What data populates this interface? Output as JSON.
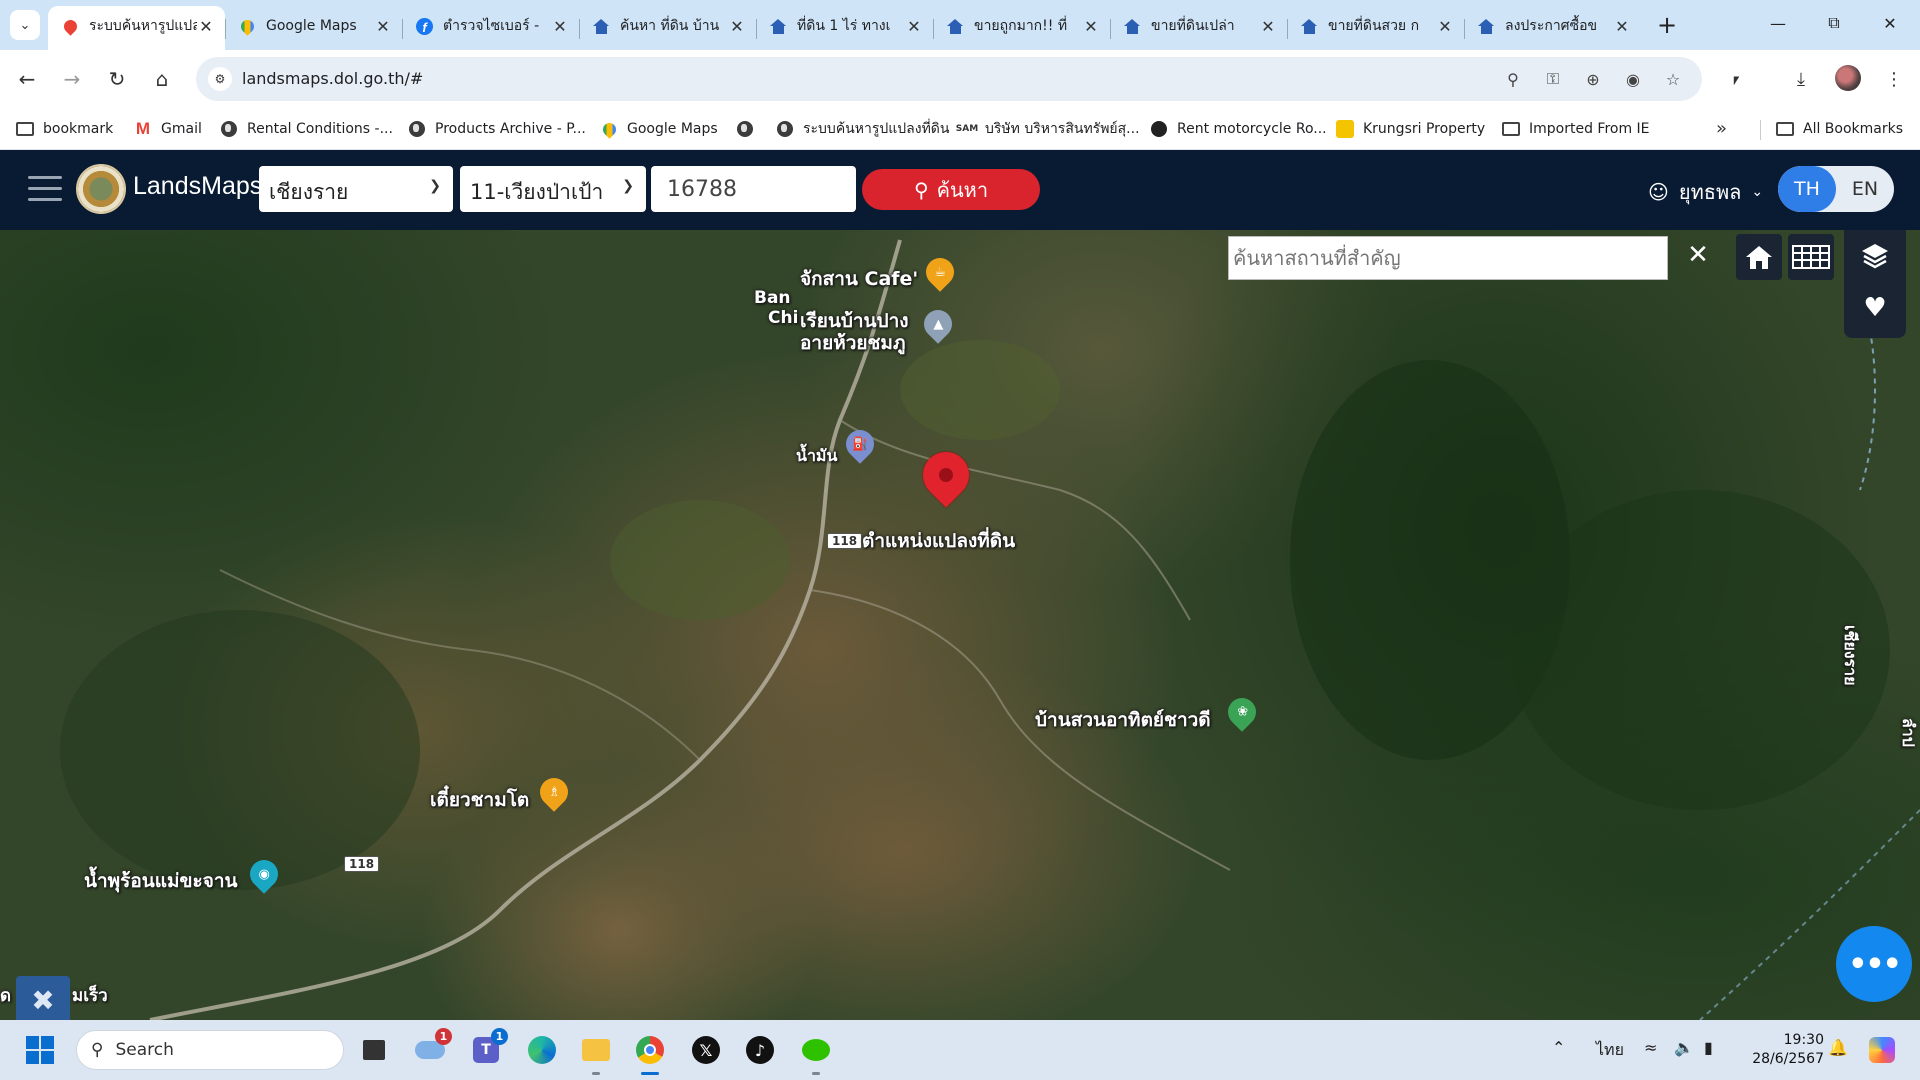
{
  "browser": {
    "tabs": [
      {
        "title": "ระบบค้นหารูปแปลงที่ดิน",
        "icon": "red-pin-icon",
        "active": true
      },
      {
        "title": "Google Maps",
        "icon": "google-maps-icon",
        "active": false
      },
      {
        "title": "ตำรวจไซเบอร์ -",
        "icon": "facebook-icon",
        "active": false
      },
      {
        "title": "ค้นหา ที่ดิน บ้าน",
        "icon": "house-icon",
        "active": false
      },
      {
        "title": "ที่ดิน 1 ไร่ ทางเ",
        "icon": "house-icon",
        "active": false
      },
      {
        "title": "ขายถูกมาก!! ที่",
        "icon": "house-icon",
        "active": false
      },
      {
        "title": "ขายที่ดินเปล่า ",
        "icon": "house-icon",
        "active": false
      },
      {
        "title": "ขายที่ดินสวย ก",
        "icon": "house-icon",
        "active": false
      },
      {
        "title": "ลงประกาศซื้อข",
        "icon": "house-icon",
        "active": false
      }
    ],
    "url": "landsmaps.dol.go.th/#",
    "bookmarks": [
      {
        "label": "bookmark",
        "icon": "folder-icon"
      },
      {
        "label": "Gmail",
        "icon": "gmail-icon"
      },
      {
        "label": "Rental Conditions -...",
        "icon": "globe-icon"
      },
      {
        "label": "Products Archive - P...",
        "icon": "globe-icon"
      },
      {
        "label": "Google Maps",
        "icon": "google-maps-icon"
      },
      {
        "label": "",
        "icon": "globe-icon"
      },
      {
        "label": "ระบบค้นหารูปแปลงที่ดิน",
        "icon": "globe-icon"
      },
      {
        "label": "บริษัท บริหารสินทรัพย์สุ...",
        "icon": "sam-icon"
      },
      {
        "label": "Rent motorcycle Ro...",
        "icon": "moto-icon"
      },
      {
        "label": "Krungsri Property",
        "icon": "krungsri-icon"
      },
      {
        "label": "Imported From IE",
        "icon": "folder-icon"
      }
    ],
    "all_bookmarks": "All Bookmarks"
  },
  "app": {
    "name": "LandsMaps",
    "province": "เชียงราย",
    "district": "11-เวียงป่าเป้า",
    "parcel_no": "16788",
    "search_label": "ค้นหา",
    "user_name": "ยุทธพล",
    "lang_th": "TH",
    "lang_en": "EN",
    "active_lang": "TH"
  },
  "map": {
    "place_search_placeholder": "ค้นหาสถานที่สำคัญ",
    "parcel_label": "ตำแหน่งแปลงที่ดิน",
    "labels": {
      "cafe": "จักสาน Cafe'",
      "ban": "Ban",
      "chi": "Chi",
      "school_1": "เรียนบ้านปาง",
      "school_2": "อายห้วยชมภู",
      "oil": "น้ำมัน",
      "road_118_top": "118",
      "road_118_bottom": "118",
      "garden": "บ้านสวนอาทิตย์ชาวดี",
      "restaurant": "เตี๋ยวชามโต",
      "hot_spring": "น้ำพุร้อนแม่ขะจาน",
      "bottom_left": "ด",
      "bottom_left_2": "มเร็ว",
      "edge_right_1": "เชียงราย",
      "edge_right_2": "ลำป"
    }
  },
  "taskbar": {
    "search_label": "Search",
    "weather_badge": "1",
    "teams_badge": "1",
    "language": "ไทย",
    "time": "19:30",
    "date": "28/6/2567"
  },
  "colors": {
    "app_header": "#091b33",
    "search_button": "#d9232d",
    "lang_active": "#2f7ee8",
    "chat_button": "#1389f0",
    "parcel_pin": "#e0232c"
  }
}
